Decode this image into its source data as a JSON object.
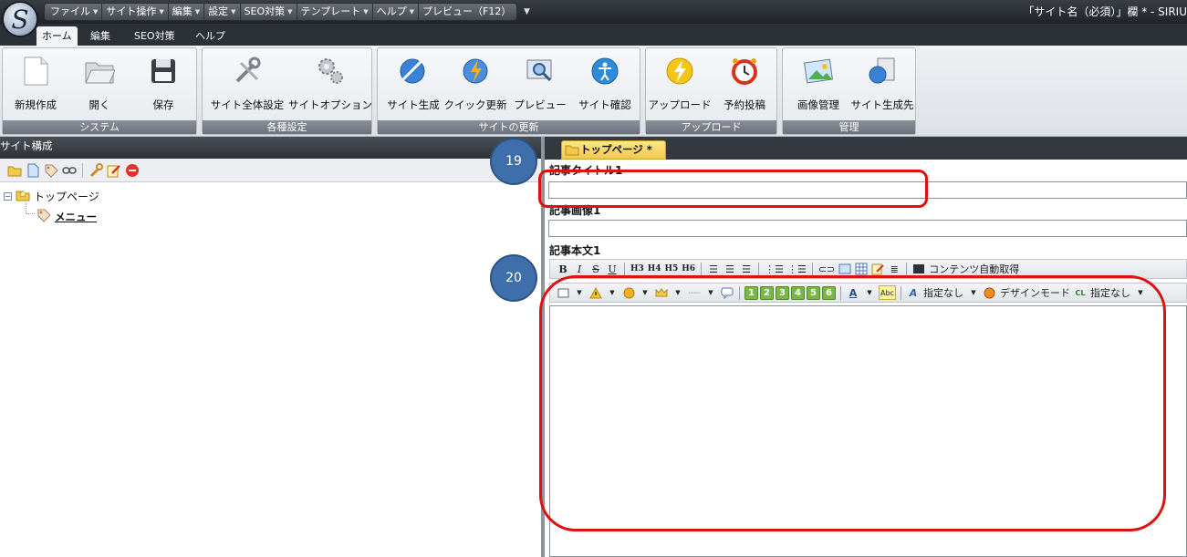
{
  "window": {
    "title": "「サイト名（必須）」欄 * - SIRIU"
  },
  "quick_menu": [
    {
      "label": "ファイル",
      "dropdown": true
    },
    {
      "label": "サイト操作",
      "dropdown": true
    },
    {
      "label": "編集",
      "dropdown": true
    },
    {
      "label": "設定",
      "dropdown": true
    },
    {
      "label": "SEO対策",
      "dropdown": true
    },
    {
      "label": "テンプレート",
      "dropdown": true
    },
    {
      "label": "ヘルプ",
      "dropdown": true
    },
    {
      "label": "プレビュー（F12）",
      "dropdown": false
    }
  ],
  "ribbon_tabs": [
    "ホーム",
    "編集",
    "SEO対策",
    "ヘルプ"
  ],
  "ribbon_active_tab": "ホーム",
  "ribbon_groups": [
    {
      "label": "システム",
      "buttons": [
        "新規作成",
        "開く",
        "保存"
      ]
    },
    {
      "label": "各種設定",
      "buttons": [
        "サイト全体設定",
        "サイトオプション"
      ]
    },
    {
      "label": "サイトの更新",
      "buttons": [
        "サイト生成",
        "クイック更新",
        "プレビュー",
        "サイト確認"
      ]
    },
    {
      "label": "アップロード",
      "buttons": [
        "アップロード",
        "予約投稿"
      ]
    },
    {
      "label": "管理",
      "buttons": [
        "画像管理",
        "サイト生成先"
      ]
    }
  ],
  "left_panel": {
    "title": "サイト構成",
    "tree": [
      {
        "label": "トップページ",
        "expanded": true,
        "level": 0
      },
      {
        "label": "メニュー",
        "level": 1
      }
    ]
  },
  "editor": {
    "doc_tab": "トップページ *",
    "field_title_label": "記事タイトル1",
    "field_title_value": "",
    "field_image_label": "記事画像1",
    "field_image_value": "",
    "field_body_label": "記事本文1",
    "toolbar1": {
      "buttons": [
        "B",
        "I",
        "S",
        "U",
        "H3",
        "H4",
        "H5",
        "H6"
      ],
      "auto_content": "コンテンツ自動取得"
    },
    "toolbar2": {
      "numbers": [
        "1",
        "2",
        "3",
        "4",
        "5",
        "6"
      ],
      "abc": "Abc",
      "font_none": "指定なし",
      "design_mode": "デザインモード",
      "class_none": "指定なし",
      "cl_label": "CL"
    }
  },
  "annotations": [
    {
      "number": "19"
    },
    {
      "number": "20"
    }
  ],
  "colors": {
    "highlight": "#e01010",
    "badge": "#3f6fab"
  }
}
